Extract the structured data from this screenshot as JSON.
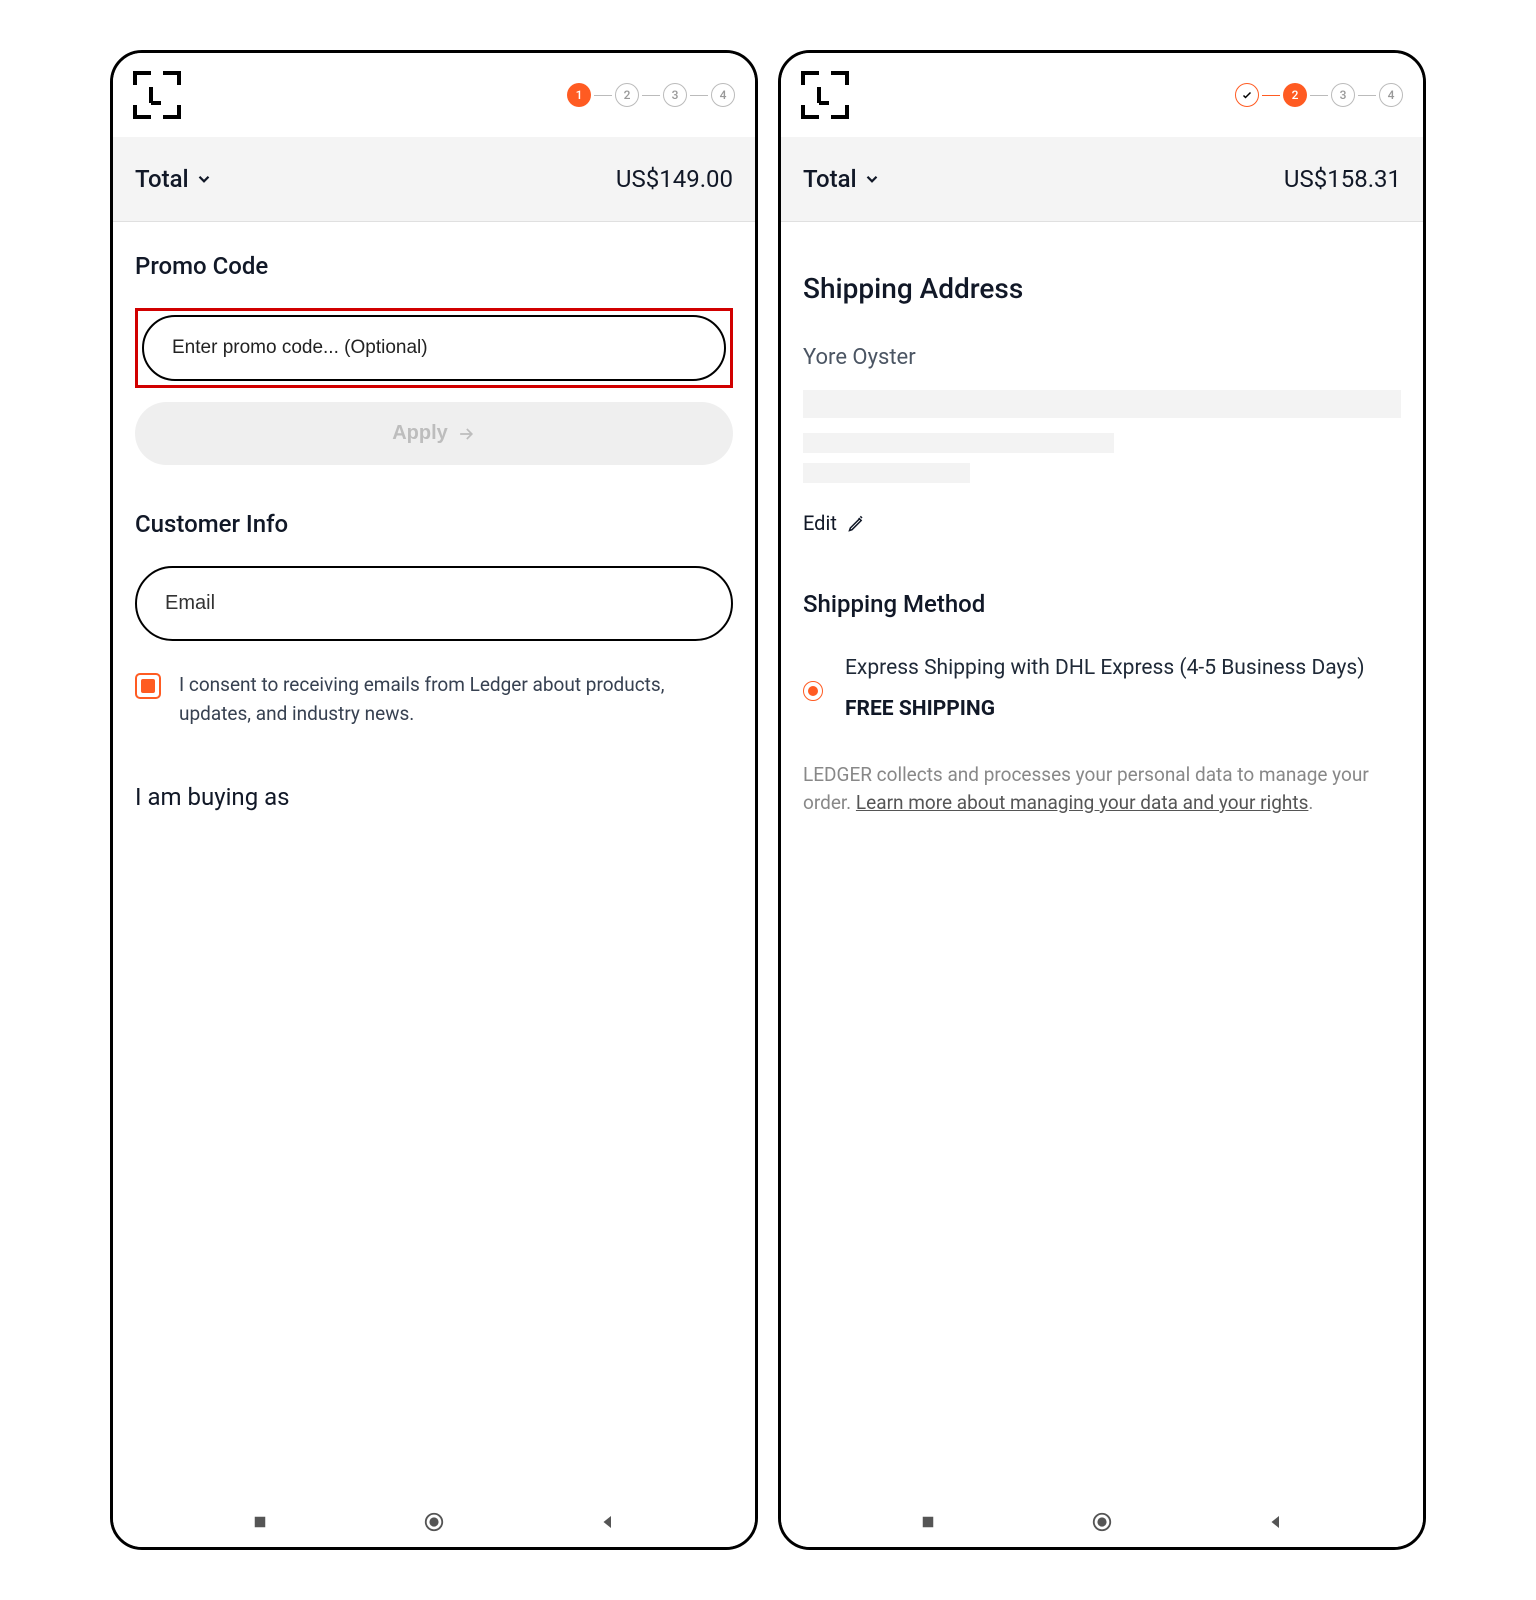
{
  "left": {
    "stepper": {
      "active": 1,
      "steps": [
        "1",
        "2",
        "3",
        "4"
      ]
    },
    "total_label": "Total",
    "total_amount": "US$149.00",
    "promo_title": "Promo Code",
    "promo_placeholder": "Enter promo code... (Optional)",
    "apply_label": "Apply",
    "cust_title": "Customer Info",
    "email_placeholder": "Email",
    "consent_text": "I consent to receiving emails from Ledger about products, updates, and industry news.",
    "buying_title": "I am buying as"
  },
  "right": {
    "stepper": {
      "active": 2,
      "steps": [
        "✓",
        "2",
        "3",
        "4"
      ]
    },
    "total_label": "Total",
    "total_amount": "US$158.31",
    "ship_addr_title": "Shipping Address",
    "addr_name": "Yore Oyster",
    "edit_label": "Edit",
    "ship_method_title": "Shipping Method",
    "ship_option_text": "Express Shipping with DHL Express (4-5 Business Days)",
    "free_shipping": "FREE SHIPPING",
    "legal_prefix": "LEDGER collects and processes your personal data to manage your order. ",
    "legal_link": "Learn more about managing your data and your rights",
    "legal_suffix": "."
  }
}
